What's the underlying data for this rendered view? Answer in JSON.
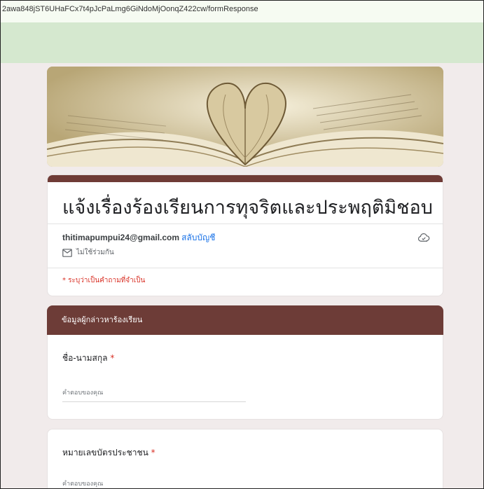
{
  "browser": {
    "url": "2awa848jST6UHaFCx7t4pJcPaLmg6GiNdoMjOonqZ422cw/formResponse"
  },
  "form": {
    "title": "แจ้งเรื่องร้องเรียนการทุจริตและประพฤติมิชอบ",
    "account_email": "thitimapumpui24@gmail.com",
    "switch_account_label": "สลับบัญชี",
    "not_shared_label": "ไม่ใช้ร่วมกัน",
    "required_note": "* ระบุว่าเป็นคำถามที่จำเป็น",
    "section_title": "ข้อมูลผู้กล่าวหาร้องเรียน",
    "questions": [
      {
        "label": "ชื่อ-นามสกุล",
        "required_mark": "*",
        "placeholder": "คำตอบของคุณ"
      },
      {
        "label": "หมายเลขบัตรประชาชน",
        "required_mark": "*",
        "placeholder": "คำตอบของคุณ"
      }
    ]
  },
  "icons": {
    "cloud": "cloud-check-icon",
    "mail": "mail-icon"
  },
  "colors": {
    "theme_header": "#6d3c37",
    "accent_green": "#d5e8cf",
    "link": "#1a73e8",
    "required": "#d93025"
  }
}
